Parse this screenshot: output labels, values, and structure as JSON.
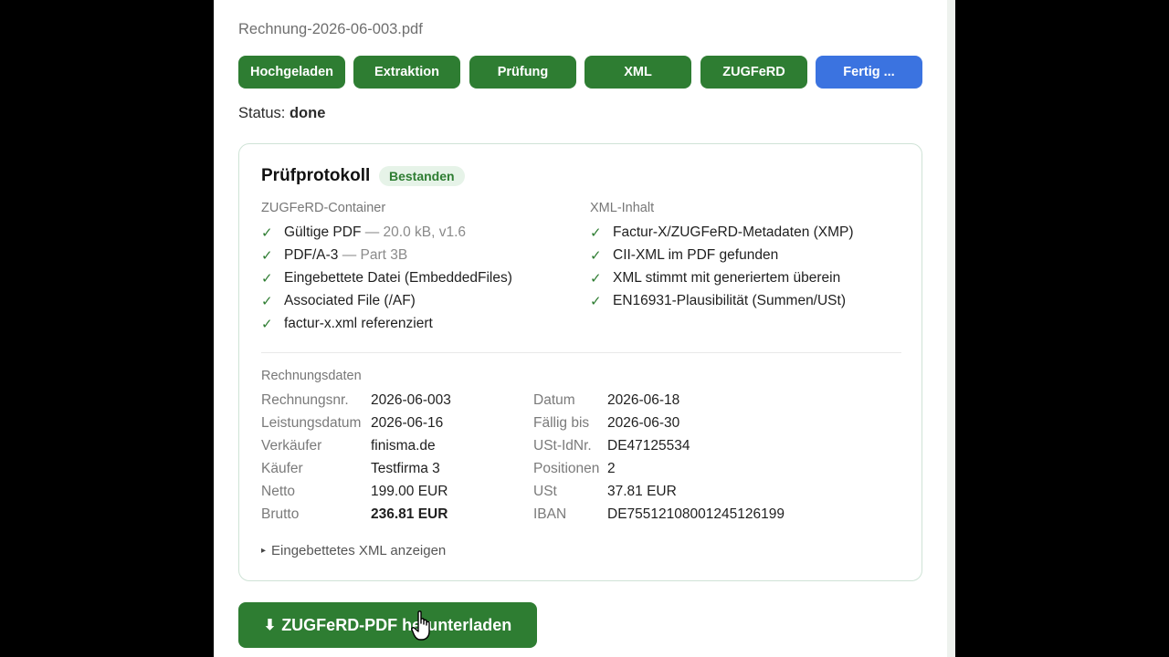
{
  "file": {
    "name": "Rechnung-2026-06-003.pdf"
  },
  "steps": [
    "Hochgeladen",
    "Extraktion",
    "Prüfung",
    "XML",
    "ZUGFeRD",
    "Fertig ..."
  ],
  "status": {
    "label": "Status:",
    "value": "done"
  },
  "protocol": {
    "title": "Prüfprotokoll",
    "badge": "Bestanden",
    "container": {
      "heading": "ZUGFeRD-Container",
      "items": [
        {
          "text": "Gültige PDF",
          "detail": "— 20.0 kB, v1.6"
        },
        {
          "text": "PDF/A-3",
          "detail": "— Part 3B"
        },
        {
          "text": "Eingebettete Datei (EmbeddedFiles)"
        },
        {
          "text": "Associated File (/AF)"
        },
        {
          "text": "factur-x.xml referenziert"
        }
      ]
    },
    "xml": {
      "heading": "XML-Inhalt",
      "items": [
        {
          "text": "Factur-X/ZUGFeRD-Metadaten (XMP)"
        },
        {
          "text": "CII-XML im PDF gefunden"
        },
        {
          "text": "XML stimmt mit generiertem überein"
        },
        {
          "text": "EN16931-Plausibilität (Summen/USt)"
        }
      ]
    },
    "check_glyph": "✓"
  },
  "invoice": {
    "heading": "Rechnungsdaten",
    "rows": [
      {
        "l1": "Rechnungsnr.",
        "v1": "2026-06-003",
        "l2": "Datum",
        "v2": "2026-06-18"
      },
      {
        "l1": "Leistungsdatum",
        "v1": "2026-06-16",
        "l2": "Fällig bis",
        "v2": "2026-06-30"
      },
      {
        "l1": "Verkäufer",
        "v1": "finisma.de",
        "l2": "USt-IdNr.",
        "v2": "DE47125534"
      },
      {
        "l1": "Käufer",
        "v1": "Testfirma 3",
        "l2": "Positionen",
        "v2": "2"
      },
      {
        "l1": "Netto",
        "v1": "199.00 EUR",
        "l2": "USt",
        "v2": "37.81 EUR"
      },
      {
        "l1": "Brutto",
        "v1": "236.81 EUR",
        "l2": "IBAN",
        "v2": "DE75512108001245126199"
      }
    ],
    "bold_value": "236.81 EUR"
  },
  "xml_toggle": {
    "arrow": "▸",
    "label": "Eingebettetes XML anzeigen"
  },
  "download": {
    "arrow": "⬇",
    "label": "ZUGFeRD-PDF herunterladen"
  },
  "colors": {
    "primary_green": "#2e7d32",
    "active_blue": "#3b73e0",
    "badge_bg": "#e6f3e8"
  }
}
